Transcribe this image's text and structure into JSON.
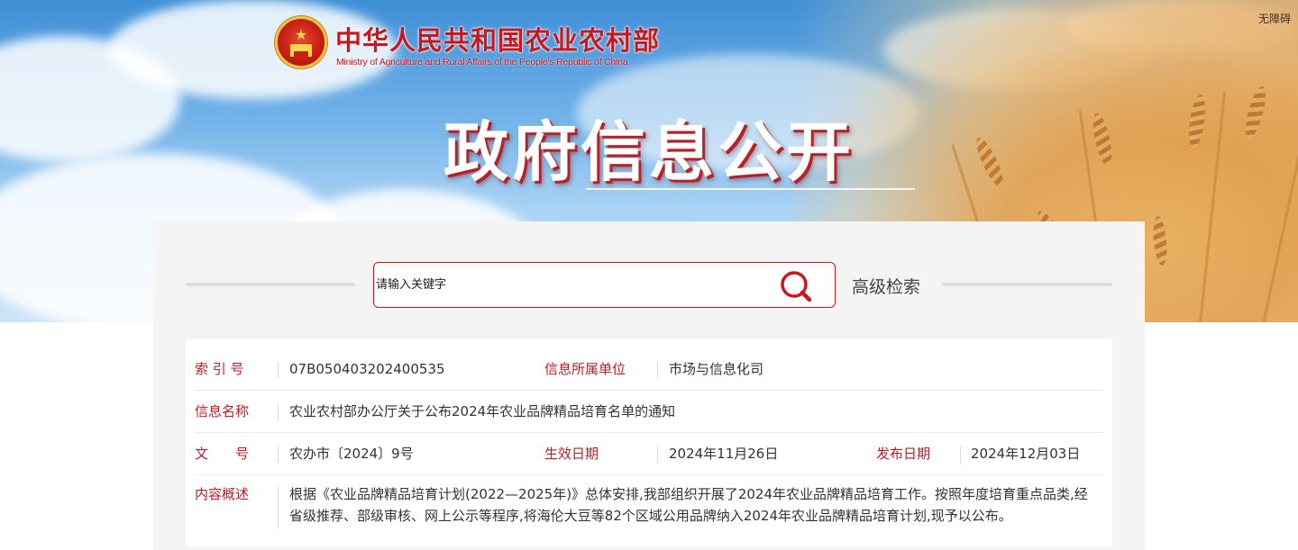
{
  "header": {
    "site_title": "中华人民共和国农业农村部",
    "site_subtitle": "Ministry of Agriculture and Rural Affairs of the People's Republic of China",
    "accessibility_link": "无障碍",
    "page_title": "政府信息公开"
  },
  "search": {
    "placeholder": "请输入关键字",
    "advanced_label": "高级检索"
  },
  "info": {
    "index_label": "索 引 号",
    "index_value": "07B050403202400535",
    "unit_label": "信息所属单位",
    "unit_value": "市场与信息化司",
    "name_label": "信息名称",
    "name_value": "农业农村部办公厅关于公布2024年农业品牌精品培育名单的通知",
    "doc_no_label": "文　　号",
    "doc_no_value": "农办市〔2024〕9号",
    "effective_label": "生效日期",
    "effective_value": "2024年11月26日",
    "publish_label": "发布日期",
    "publish_value": "2024年12月03日",
    "summary_label": "内容概述",
    "summary_value": "根据《农业品牌精品培育计划(2022—2025年)》总体安排,我部组织开展了2024年农业品牌精品培育工作。按照年度培育重点品类,经省级推荐、部级审核、网上公示等程序,将海伦大豆等82个区域公用品牌纳入2024年农业品牌精品培育计划,现予以公布。"
  },
  "colors": {
    "brand_red": "#c9171e",
    "label_red": "#b4202a"
  }
}
